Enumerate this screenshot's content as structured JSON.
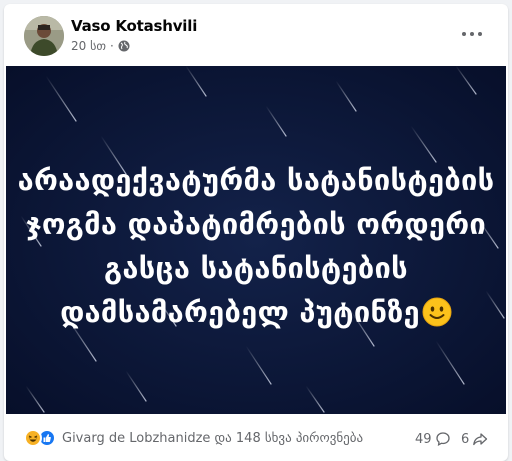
{
  "post": {
    "author": "Vaso Kotashvili",
    "time": "20 სთ",
    "separator": "·",
    "privacy_icon": "globe-icon",
    "menu_icon": "more-horizontal-icon",
    "text_lines": [
      "არაადექვატურმა სატანისტების",
      "ჯოგმა დაპატიმრების ორდერი",
      "გასცა სატანისტების",
      "დამსამარებელ პუტინზე"
    ],
    "emoji_icon": "slightly-smiling-face-icon",
    "background_color": "#0c1a3d"
  },
  "footer": {
    "reaction_icons": [
      "haha-reaction-icon",
      "like-reaction-icon"
    ],
    "reactions_text": "Givarg de Lobzhanidze და 148 სხვა პიროვნება",
    "comments_count": "49",
    "comment_icon": "comment-bubble-icon",
    "shares_count": "6",
    "share_icon": "share-arrow-icon"
  }
}
